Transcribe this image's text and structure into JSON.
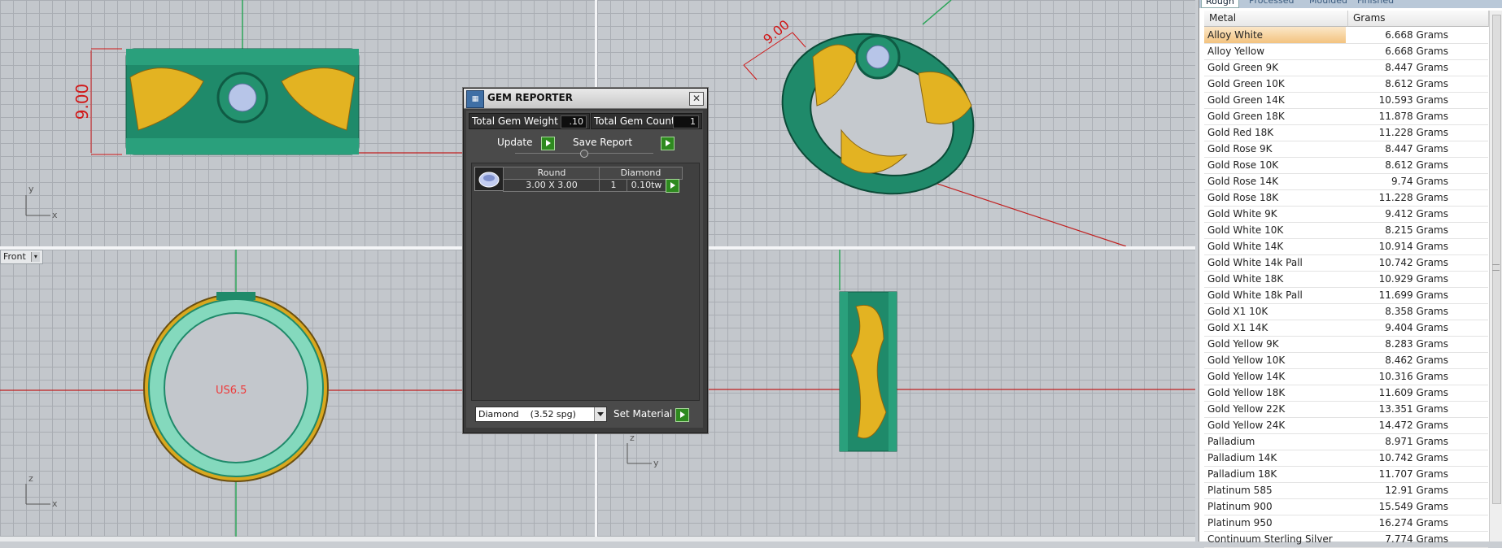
{
  "viewports": {
    "top": {
      "dimension_value": "9.00",
      "axis_y": "y",
      "axis_x": "x"
    },
    "perspective": {
      "dimension_value": "9.00"
    },
    "front": {
      "label": "Front",
      "axis_z": "z",
      "axis_x": "x",
      "size_mark": "US6.5"
    },
    "right": {
      "axis_z": "z",
      "axis_y": "y"
    }
  },
  "gem_reporter": {
    "title": "GEM REPORTER",
    "total_weight_label": "Total Gem Weight",
    "total_weight_value": ".10",
    "total_count_label": "Total Gem Count",
    "total_count_value": "1",
    "update_label": "Update",
    "save_report_label": "Save Report",
    "gem_row": {
      "shape": "Round",
      "material": "Diamond",
      "size": "3.00 X 3.00",
      "count": "1",
      "weight": "0.10tw"
    },
    "material_select": "Diamond    (3.52 spg)",
    "set_material_label": "Set Material"
  },
  "metal_panel": {
    "tabs": [
      "Rough",
      "Processed",
      "Moulded",
      "Finished"
    ],
    "active_tab": "Rough",
    "columns": [
      "Metal",
      "Grams"
    ],
    "rows": [
      {
        "metal": "Alloy White",
        "grams": "6.668 Grams"
      },
      {
        "metal": "Alloy Yellow",
        "grams": "6.668 Grams"
      },
      {
        "metal": "Gold Green 9K",
        "grams": "8.447 Grams"
      },
      {
        "metal": "Gold Green 10K",
        "grams": "8.612 Grams"
      },
      {
        "metal": "Gold Green 14K",
        "grams": "10.593 Grams"
      },
      {
        "metal": "Gold Green 18K",
        "grams": "11.878 Grams"
      },
      {
        "metal": "Gold Red 18K",
        "grams": "11.228 Grams"
      },
      {
        "metal": "Gold Rose 9K",
        "grams": "8.447 Grams"
      },
      {
        "metal": "Gold Rose 10K",
        "grams": "8.612 Grams"
      },
      {
        "metal": "Gold Rose 14K",
        "grams": "9.74 Grams"
      },
      {
        "metal": "Gold Rose 18K",
        "grams": "11.228 Grams"
      },
      {
        "metal": "Gold White 9K",
        "grams": "9.412 Grams"
      },
      {
        "metal": "Gold White 10K",
        "grams": "8.215 Grams"
      },
      {
        "metal": "Gold White 14K",
        "grams": "10.914 Grams"
      },
      {
        "metal": "Gold White 14k Pall",
        "grams": "10.742 Grams"
      },
      {
        "metal": "Gold White 18K",
        "grams": "10.929 Grams"
      },
      {
        "metal": "Gold White 18k Pall",
        "grams": "11.699 Grams"
      },
      {
        "metal": "Gold X1 10K",
        "grams": "8.358 Grams"
      },
      {
        "metal": "Gold X1 14K",
        "grams": "9.404 Grams"
      },
      {
        "metal": "Gold Yellow 9K",
        "grams": "8.283 Grams"
      },
      {
        "metal": "Gold Yellow 10K",
        "grams": "8.462 Grams"
      },
      {
        "metal": "Gold Yellow 14K",
        "grams": "10.316 Grams"
      },
      {
        "metal": "Gold Yellow 18K",
        "grams": "11.609 Grams"
      },
      {
        "metal": "Gold Yellow 22K",
        "grams": "13.351 Grams"
      },
      {
        "metal": "Gold Yellow 24K",
        "grams": "14.472 Grams"
      },
      {
        "metal": "Palladium",
        "grams": "8.971 Grams"
      },
      {
        "metal": "Palladium 14K",
        "grams": "10.742 Grams"
      },
      {
        "metal": "Palladium 18K",
        "grams": "11.707 Grams"
      },
      {
        "metal": "Platinum 585",
        "grams": "12.91 Grams"
      },
      {
        "metal": "Platinum 900",
        "grams": "15.549 Grams"
      },
      {
        "metal": "Platinum 950",
        "grams": "16.274 Grams"
      },
      {
        "metal": "Continuum Sterling Silver",
        "grams": "7.774 Grams"
      }
    ],
    "selected_index": 0
  },
  "colors": {
    "ring_green": "#1f8a6a",
    "ring_gold": "#e3b322",
    "viewport_bg": "#c3c7cc",
    "dimension_red": "#d01818"
  }
}
